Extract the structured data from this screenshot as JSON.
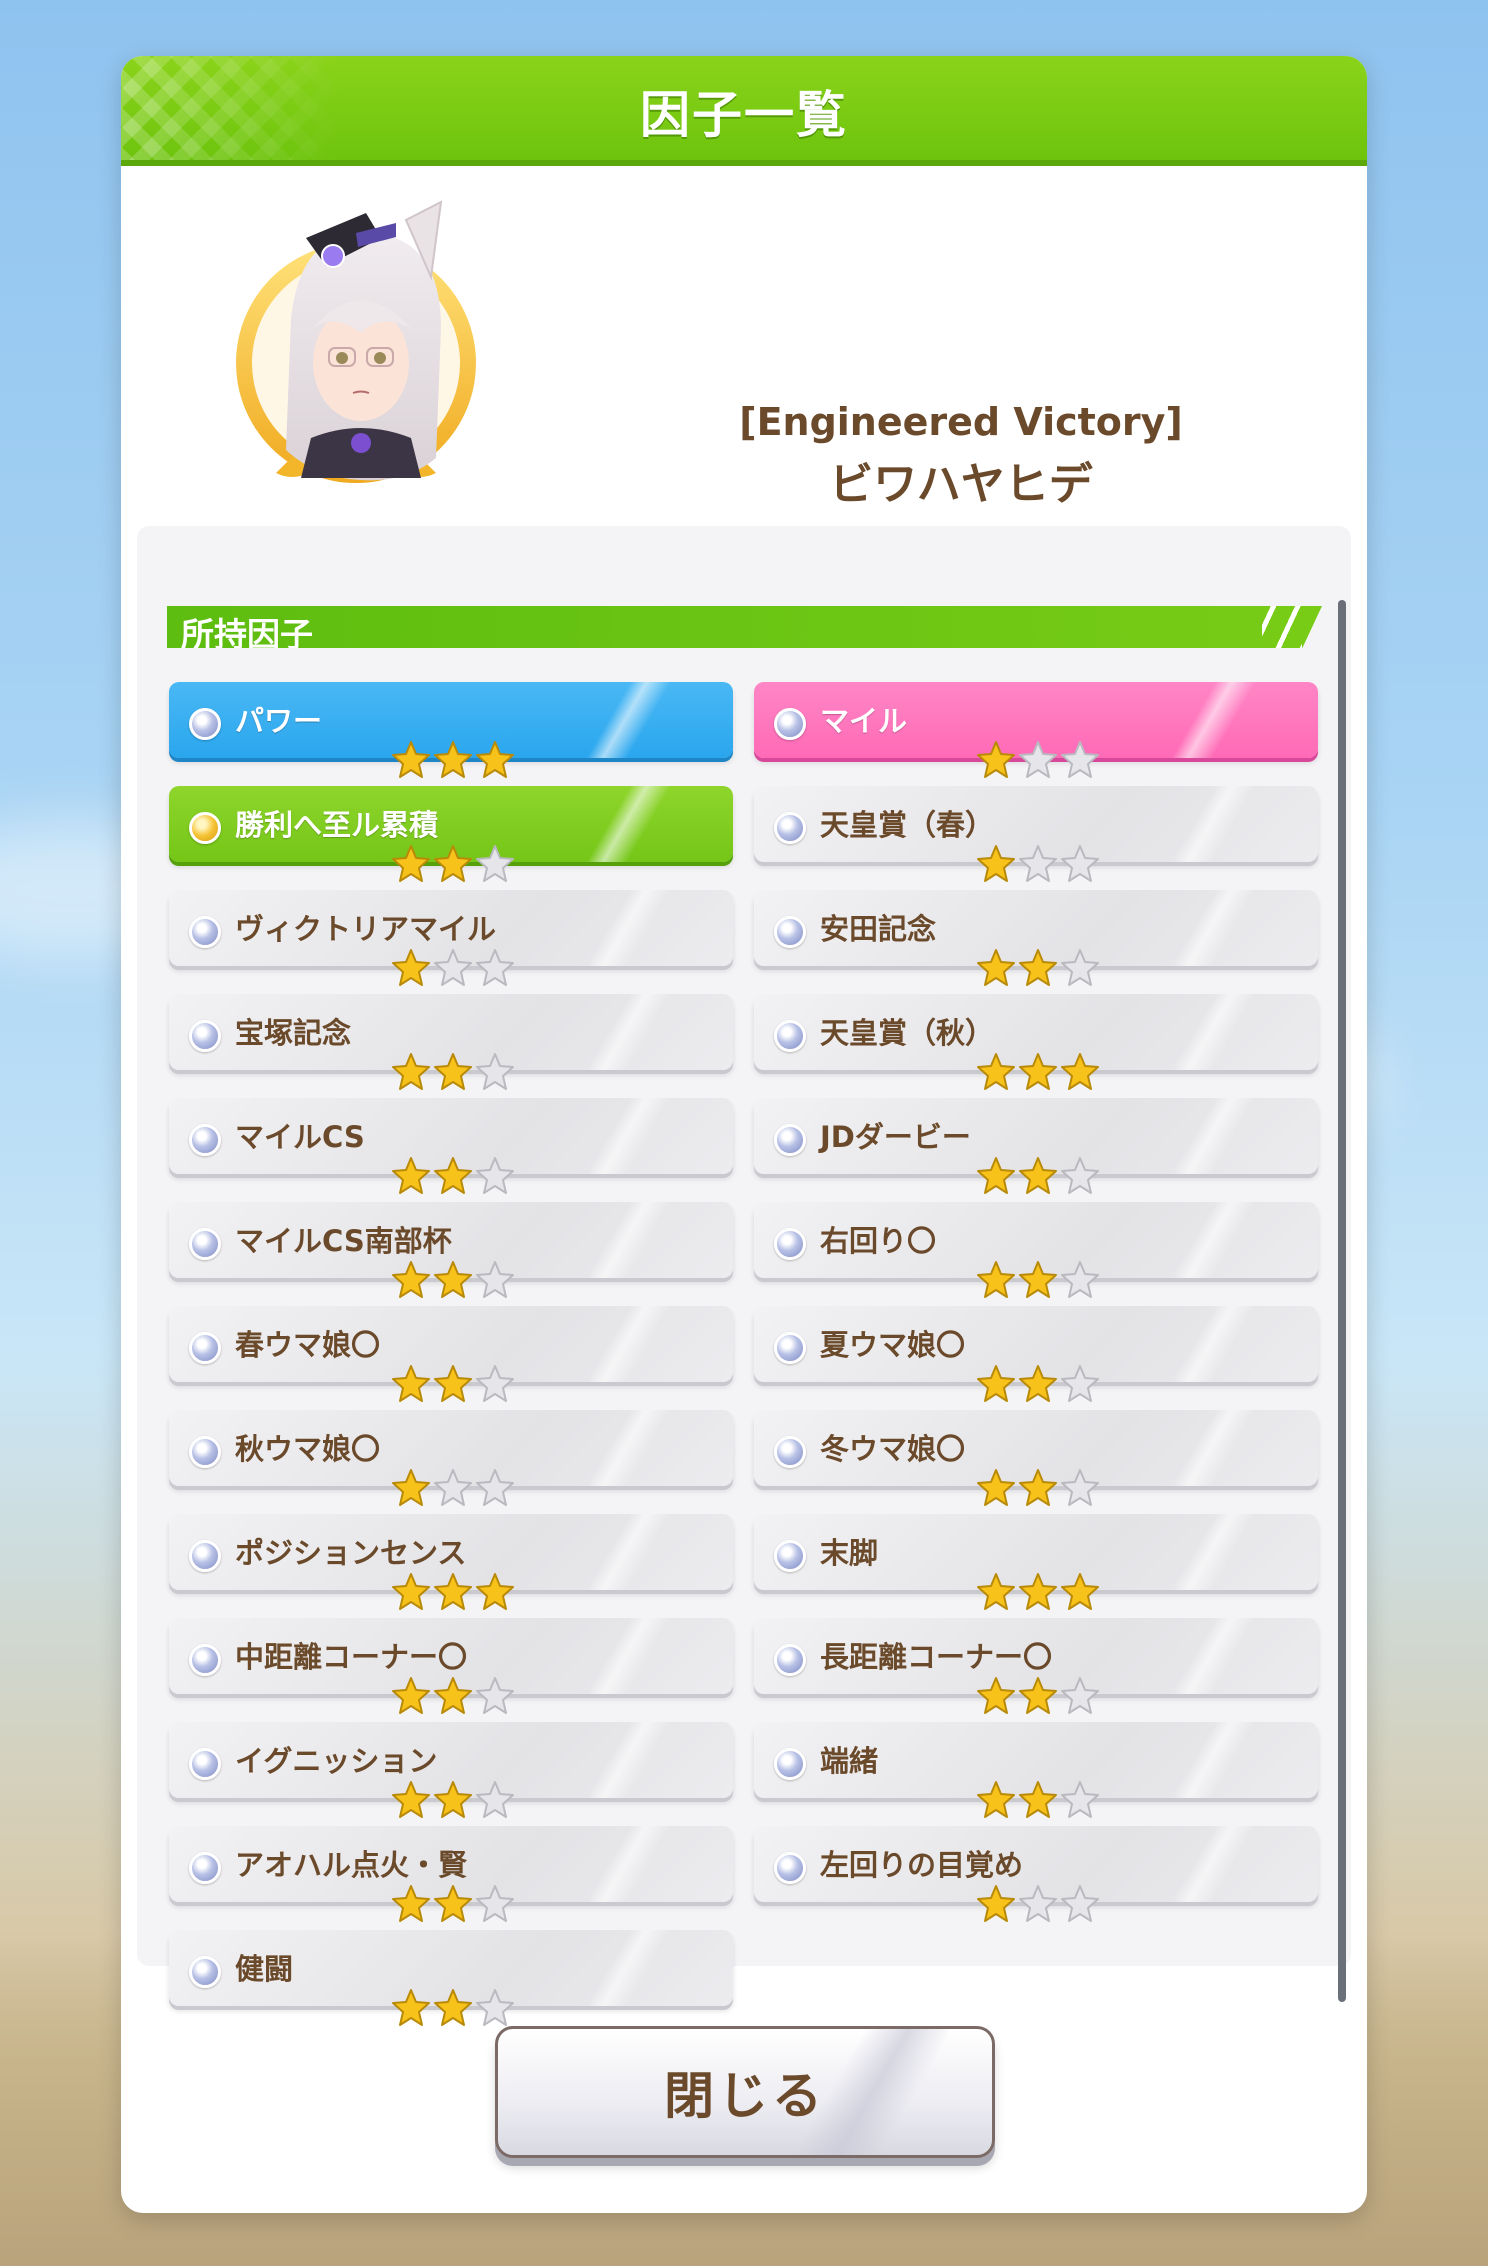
{
  "dialog": {
    "title": "因子一覧",
    "close_label": "閉じる"
  },
  "character": {
    "epithet": "[Engineered Victory]",
    "name": "ビワハヤヒデ"
  },
  "section": {
    "title": "所持因子"
  },
  "factors": [
    {
      "label": "パワー",
      "stars": 3,
      "kind": "blue"
    },
    {
      "label": "マイル",
      "stars": 1,
      "kind": "pink"
    },
    {
      "label": "勝利へ至ル累積",
      "stars": 2,
      "kind": "green"
    },
    {
      "label": "天皇賞（春）",
      "stars": 1,
      "kind": "normal"
    },
    {
      "label": "ヴィクトリアマイル",
      "stars": 1,
      "kind": "normal"
    },
    {
      "label": "安田記念",
      "stars": 2,
      "kind": "normal"
    },
    {
      "label": "宝塚記念",
      "stars": 2,
      "kind": "normal"
    },
    {
      "label": "天皇賞（秋）",
      "stars": 3,
      "kind": "normal"
    },
    {
      "label": "マイルCS",
      "stars": 2,
      "kind": "normal"
    },
    {
      "label": "JDダービー",
      "stars": 2,
      "kind": "normal"
    },
    {
      "label": "マイルCS南部杯",
      "stars": 2,
      "kind": "normal"
    },
    {
      "label": "右回り〇",
      "stars": 2,
      "kind": "normal"
    },
    {
      "label": "春ウマ娘〇",
      "stars": 2,
      "kind": "normal"
    },
    {
      "label": "夏ウマ娘〇",
      "stars": 2,
      "kind": "normal"
    },
    {
      "label": "秋ウマ娘〇",
      "stars": 1,
      "kind": "normal"
    },
    {
      "label": "冬ウマ娘〇",
      "stars": 2,
      "kind": "normal"
    },
    {
      "label": "ポジションセンス",
      "stars": 3,
      "kind": "normal"
    },
    {
      "label": "末脚",
      "stars": 3,
      "kind": "normal"
    },
    {
      "label": "中距離コーナー〇",
      "stars": 2,
      "kind": "normal"
    },
    {
      "label": "長距離コーナー〇",
      "stars": 2,
      "kind": "normal"
    },
    {
      "label": "イグニッション",
      "stars": 2,
      "kind": "normal"
    },
    {
      "label": "端緒",
      "stars": 2,
      "kind": "normal"
    },
    {
      "label": "アオハル点火・賢",
      "stars": 2,
      "kind": "normal"
    },
    {
      "label": "左回りの目覚め",
      "stars": 1,
      "kind": "normal"
    },
    {
      "label": "健闘",
      "stars": 2,
      "kind": "normal"
    }
  ],
  "colors": {
    "header_green": "#7ccb12",
    "text_brown": "#6b4a2b",
    "star_gold": "#f7c21a",
    "star_empty": "#e6e6ea"
  }
}
